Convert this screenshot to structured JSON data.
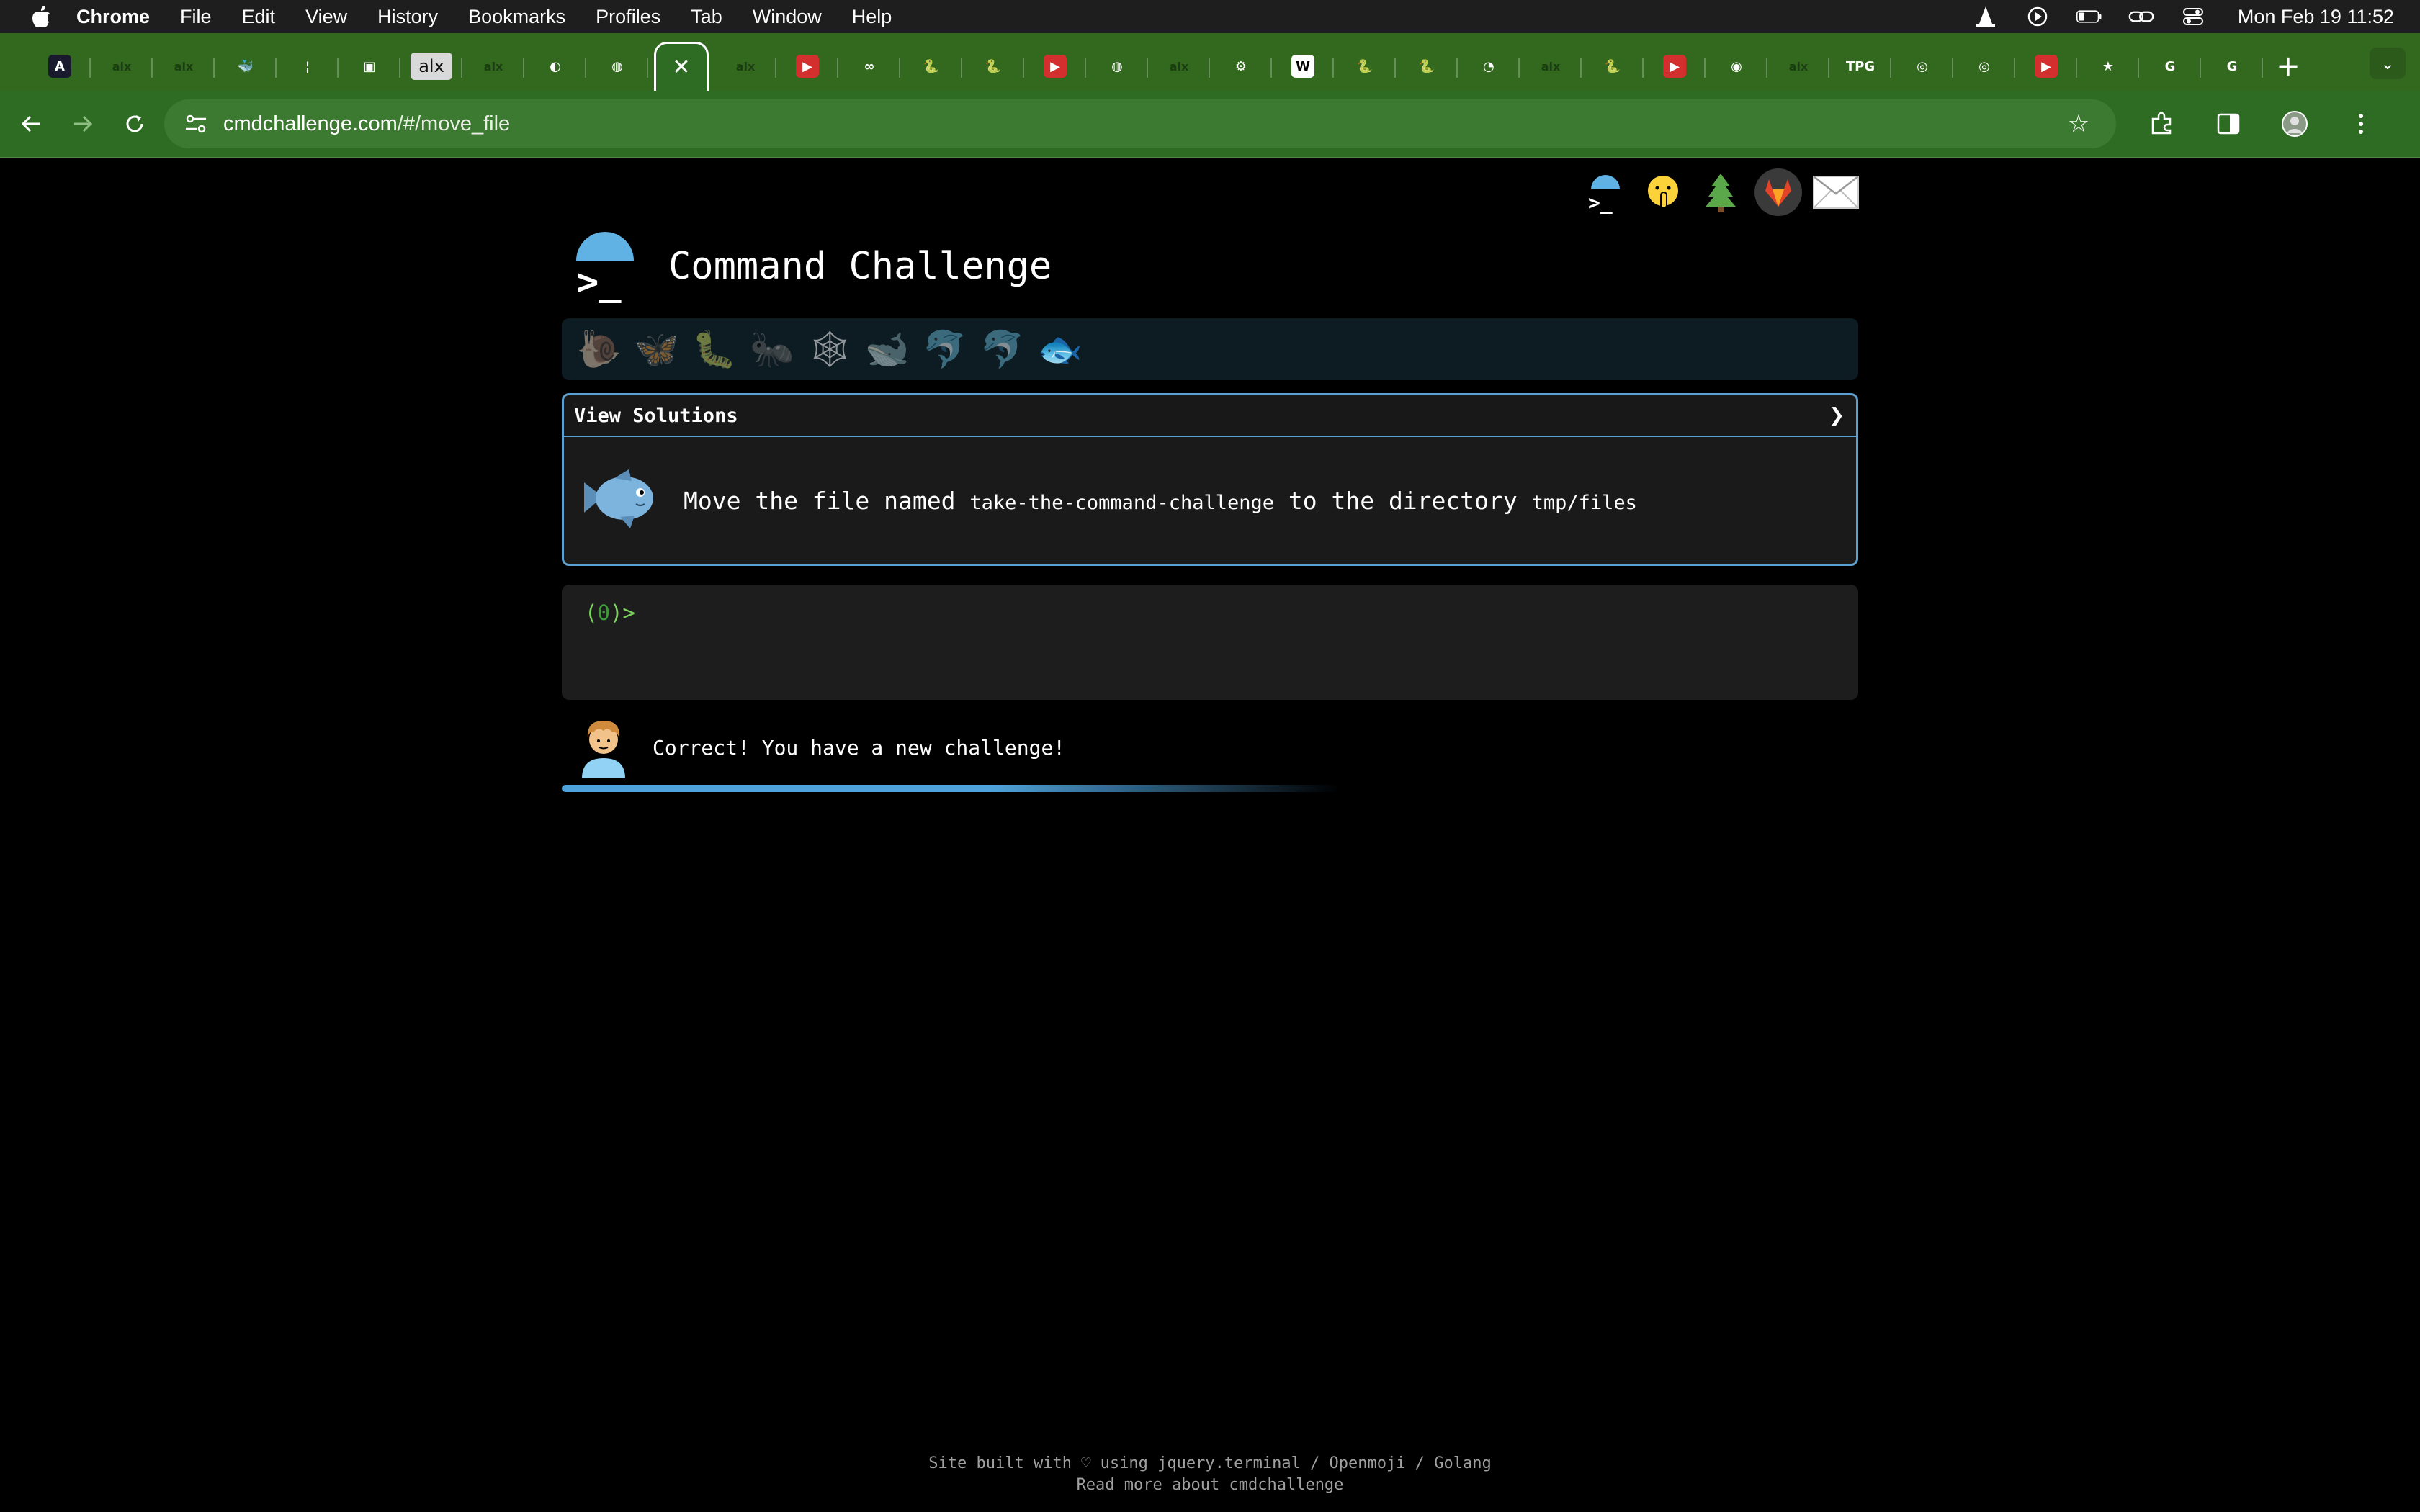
{
  "menubar": {
    "apple": "",
    "app_name": "Chrome",
    "items": [
      "File",
      "Edit",
      "View",
      "History",
      "Bookmarks",
      "Profiles",
      "Tab",
      "Window",
      "Help"
    ],
    "clock": "Mon Feb 19  11:52"
  },
  "tabs": [
    {
      "icon": "A",
      "color": "#1a1a2e"
    },
    {
      "icon": "alx",
      "color": "transparent"
    },
    {
      "icon": "alx",
      "color": "transparent"
    },
    {
      "icon": "🐳",
      "color": "transparent"
    },
    {
      "icon": "¦",
      "color": "transparent"
    },
    {
      "icon": "▣",
      "color": "transparent"
    },
    {
      "icon": "alx",
      "color": "light"
    },
    {
      "icon": "alx",
      "color": "transparent"
    },
    {
      "icon": "◐",
      "color": "transparent"
    },
    {
      "icon": "◍",
      "color": "transparent"
    },
    {
      "icon": "✕",
      "color": "active"
    },
    {
      "icon": "alx",
      "color": "transparent"
    },
    {
      "icon": "▶",
      "color": "#d32f2f"
    },
    {
      "icon": "∞",
      "color": "transparent"
    },
    {
      "icon": "🐍",
      "color": "transparent"
    },
    {
      "icon": "🐍",
      "color": "transparent"
    },
    {
      "icon": "▶",
      "color": "#d32f2f"
    },
    {
      "icon": "◍",
      "color": "transparent"
    },
    {
      "icon": "alx",
      "color": "transparent"
    },
    {
      "icon": "⚙",
      "color": "transparent"
    },
    {
      "icon": "W",
      "color": "#ffffff"
    },
    {
      "icon": "🐍",
      "color": "transparent"
    },
    {
      "icon": "🐍",
      "color": "transparent"
    },
    {
      "icon": "◔",
      "color": "transparent"
    },
    {
      "icon": "alx",
      "color": "transparent"
    },
    {
      "icon": "🐍",
      "color": "transparent"
    },
    {
      "icon": "▶",
      "color": "#d32f2f"
    },
    {
      "icon": "◉",
      "color": "transparent"
    },
    {
      "icon": "alx",
      "color": "transparent"
    },
    {
      "icon": "TPG",
      "color": "transparent"
    },
    {
      "icon": "◎",
      "color": "transparent"
    },
    {
      "icon": "◎",
      "color": "transparent"
    },
    {
      "icon": "▶",
      "color": "#d32f2f"
    },
    {
      "icon": "★",
      "color": "transparent"
    },
    {
      "icon": "G",
      "color": "transparent"
    },
    {
      "icon": "G",
      "color": "transparent"
    }
  ],
  "toolbar": {
    "url_host": "cmdchallenge.com",
    "url_path": "/#/move_file"
  },
  "page": {
    "title": "Command Challenge",
    "logo_prompt": ">_",
    "social_icons": [
      "cmdchallenge-logo-icon",
      "shush-face-icon",
      "tree-icon",
      "gitlab-icon",
      "mail-icon"
    ],
    "levels": [
      "🐌",
      "🦋",
      "🐛",
      "🐜",
      "🕸",
      "🐋",
      "🐬",
      "🐬",
      "🐟"
    ],
    "solutions_label": "View Solutions",
    "solutions_arrow": "❯",
    "challenge_fish": "🐟",
    "challenge": {
      "prefix": "Move the file named ",
      "file": "take-the-command-challenge",
      "middle": " to the directory ",
      "dir": "tmp/files"
    },
    "prompt_open": "(",
    "prompt_num": "0",
    "prompt_close": ")>",
    "avatar": "🧑‍🦱",
    "feedback": "Correct! You have a new challenge!",
    "progress_fraction": 0.6,
    "footer_line1": "Site built with ♡ using jquery.terminal / Openmoji / Golang",
    "footer_line2": "Read more about cmdchallenge"
  }
}
